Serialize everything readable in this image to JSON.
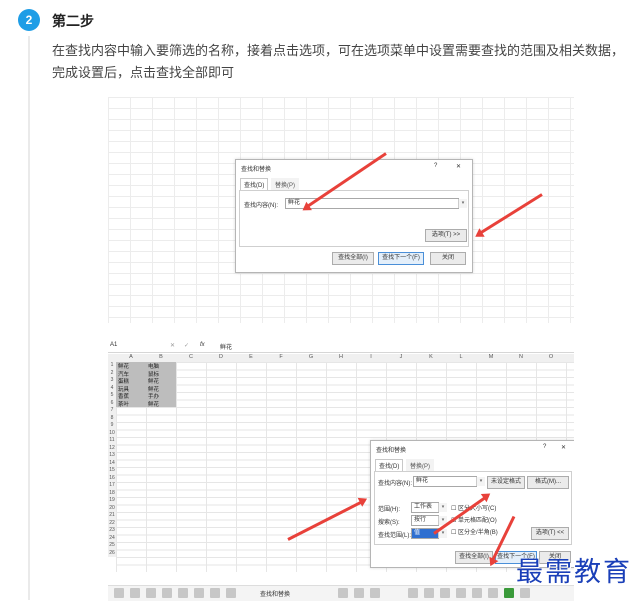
{
  "step": {
    "number": "2",
    "title": "第二步"
  },
  "description": "在查找内容中输入要筛选的名称，接着点击选项，可在选项菜单中设置需要查找的范围及相关数据，完成设置后，点击查找全部即可",
  "dialog1": {
    "title": "查找和替换",
    "help": "?",
    "close": "✕",
    "tab_find": "查找(D)",
    "tab_replace": "替换(P)",
    "find_label": "查找内容(N):",
    "find_value": "鲜花",
    "options_btn": "选项(T) >>",
    "find_all": "查找全部(I)",
    "find_next": "查找下一个(F)",
    "close_btn": "关闭"
  },
  "sheet": {
    "name_box": "A1",
    "fx": "fx",
    "formula": "鲜花",
    "columns": [
      "A",
      "B",
      "C",
      "D",
      "E",
      "F",
      "G",
      "H",
      "I",
      "J",
      "K",
      "L",
      "M",
      "N",
      "O"
    ],
    "rows": [
      "1",
      "2",
      "3",
      "4",
      "5",
      "6",
      "7",
      "8",
      "9",
      "10",
      "11",
      "12",
      "13",
      "14",
      "15",
      "16",
      "17",
      "18",
      "19",
      "20",
      "21",
      "22",
      "23",
      "24",
      "25",
      "26"
    ],
    "data": [
      [
        "鲜花",
        "电脑"
      ],
      [
        "汽车",
        "鼠标"
      ],
      [
        "蛋糕",
        "鲜花"
      ],
      [
        "玩具",
        "鲜花"
      ],
      [
        "香蕉",
        "手办"
      ],
      [
        "茶叶",
        "鲜花"
      ]
    ]
  },
  "dialog2": {
    "title": "查找和替换",
    "help": "?",
    "close": "✕",
    "tab_find": "查找(D)",
    "tab_replace": "替换(P)",
    "find_label": "查找内容(N):",
    "find_value": "鲜花",
    "no_format": "未设定格式",
    "format_btn": "格式(M)...",
    "within_label": "范围(H):",
    "within_value": "工作表",
    "search_label": "搜索(S):",
    "search_value": "按行",
    "lookin_label": "查找范围(L):",
    "lookin_value": "值",
    "opt_case": "区分大小写(C)",
    "opt_whole": "单元格匹配(O)",
    "opt_width": "区分全/半角(B)",
    "options_btn": "选项(T) <<",
    "find_all": "查找全部(I)",
    "find_next": "查找下一个(F)",
    "close_btn": "关闭"
  },
  "taskbar": {
    "item1": "查找和替换"
  },
  "watermark": "最需教育"
}
